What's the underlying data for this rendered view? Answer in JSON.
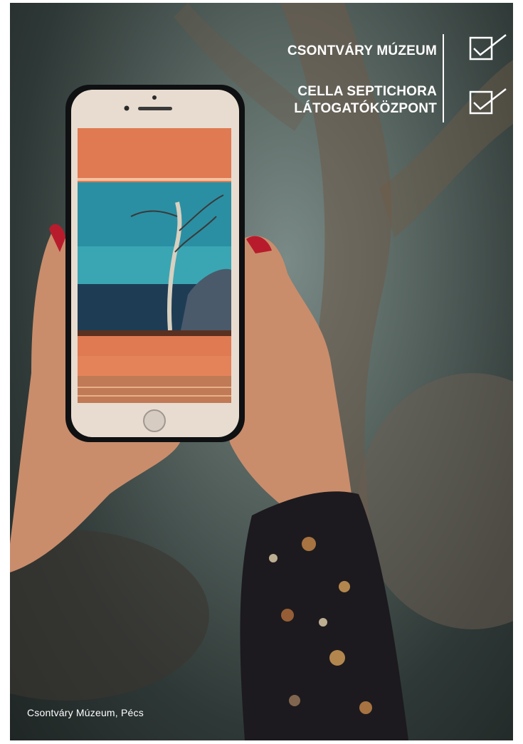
{
  "labels": [
    {
      "text": "CSONTVÁRY MÚZEUM",
      "checked": true
    },
    {
      "text": "CELLA SEPTICHORA",
      "text2": "LÁTOGATÓKÖZPONT",
      "checked": true
    }
  ],
  "caption": "Csontváry Múzeum, Pécs",
  "colors": {
    "accent": "#ffffff",
    "phone_wall": "#e07a52",
    "painting_sky": "#3aa6b3"
  }
}
